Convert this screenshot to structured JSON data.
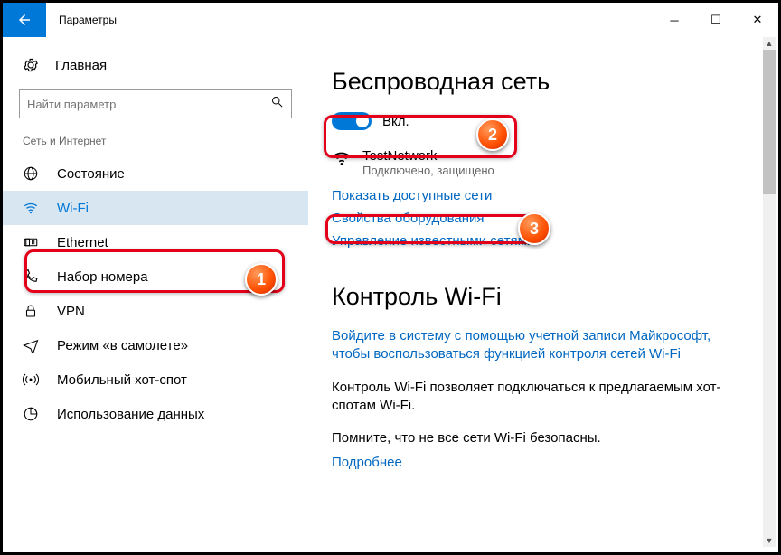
{
  "title": "Параметры",
  "home_label": "Главная",
  "search": {
    "placeholder": "Найти параметр"
  },
  "category_label": "Сеть и Интернет",
  "sidebar": {
    "items": [
      {
        "label": "Состояние"
      },
      {
        "label": "Wi-Fi"
      },
      {
        "label": "Ethernet"
      },
      {
        "label": "Набор номера"
      },
      {
        "label": "VPN"
      },
      {
        "label": "Режим «в самолете»"
      },
      {
        "label": "Мобильный хот-спот"
      },
      {
        "label": "Использование данных"
      }
    ]
  },
  "main": {
    "heading": "Беспроводная сеть",
    "toggle_label": "Вкл.",
    "network": {
      "name": "TestNetwork",
      "status": "Подключено, защищено"
    },
    "links": {
      "show_networks": "Показать доступные сети",
      "hw_props": "Свойства оборудования",
      "manage_known": "Управление известными сетями"
    },
    "wifi_control": {
      "heading": "Контроль Wi-Fi",
      "signin_link": "Войдите в систему с помощью учетной записи Майкрософт, чтобы воспользоваться функцией контроля сетей Wi-Fi",
      "body1": "Контроль Wi-Fi позволяет подключаться к предлагаемым хот-спотам Wi-Fi.",
      "body2": "Помните, что не все сети Wi-Fi безопасны.",
      "more_link": "Подробнее"
    }
  },
  "annotations": {
    "a1": "1",
    "a2": "2",
    "a3": "3"
  }
}
